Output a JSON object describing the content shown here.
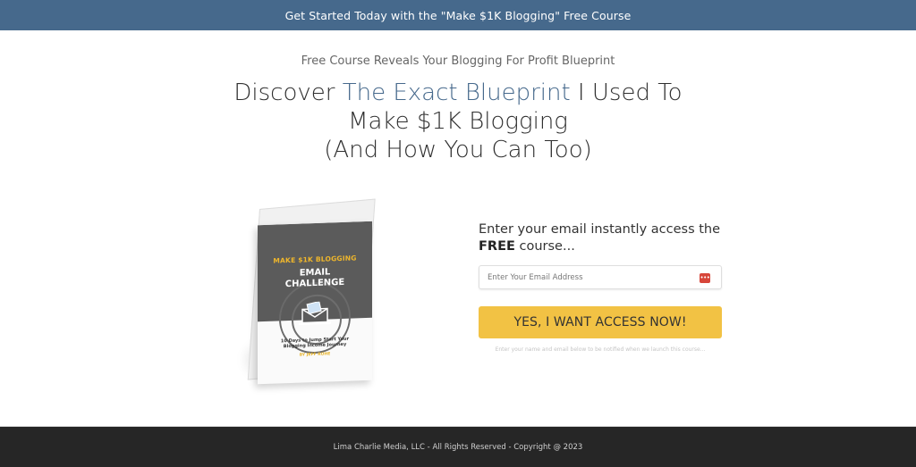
{
  "topbar": {
    "text": "Get Started Today with the \"Make $1K Blogging\" Free Course",
    "background_color": "#46698c"
  },
  "hero": {
    "subheading": "Free Course Reveals Your Blogging For Profit Blueprint",
    "headline_part1": "Discover ",
    "headline_accent": "The Exact Blueprint",
    "headline_part2": " I Used To",
    "headline_line2": "Make $1K Blogging",
    "headline_line3": "(And How You Can Too)",
    "accent_color": "#46698c"
  },
  "book": {
    "title_line1": "MAKE $1K BLOGGING",
    "title_line2a": "EMAIL",
    "title_line2b": "CHALLENGE",
    "subtitle_line1": "10 Days to Jump Start Your",
    "subtitle_line2": "Blogging Income Journey",
    "author": "BY JEFF ROHE",
    "icon": "envelope-laptop-icon"
  },
  "form": {
    "title_part1": "Enter your email instantly access the ",
    "title_bold": "FREE",
    "title_part2": " course...",
    "email_placeholder": "Enter Your Email Address",
    "email_value": "",
    "autofill_icon": "password-manager-icon",
    "submit_label": "YES, I WANT ACCESS NOW!",
    "button_color": "#f2c244",
    "note": "Enter your name and email below to be notified when we launch this course..."
  },
  "footer": {
    "text": "Lima Charlie Media, LLC - All Rights Reserved - Copyright @ 2023",
    "background_color": "#262626"
  }
}
